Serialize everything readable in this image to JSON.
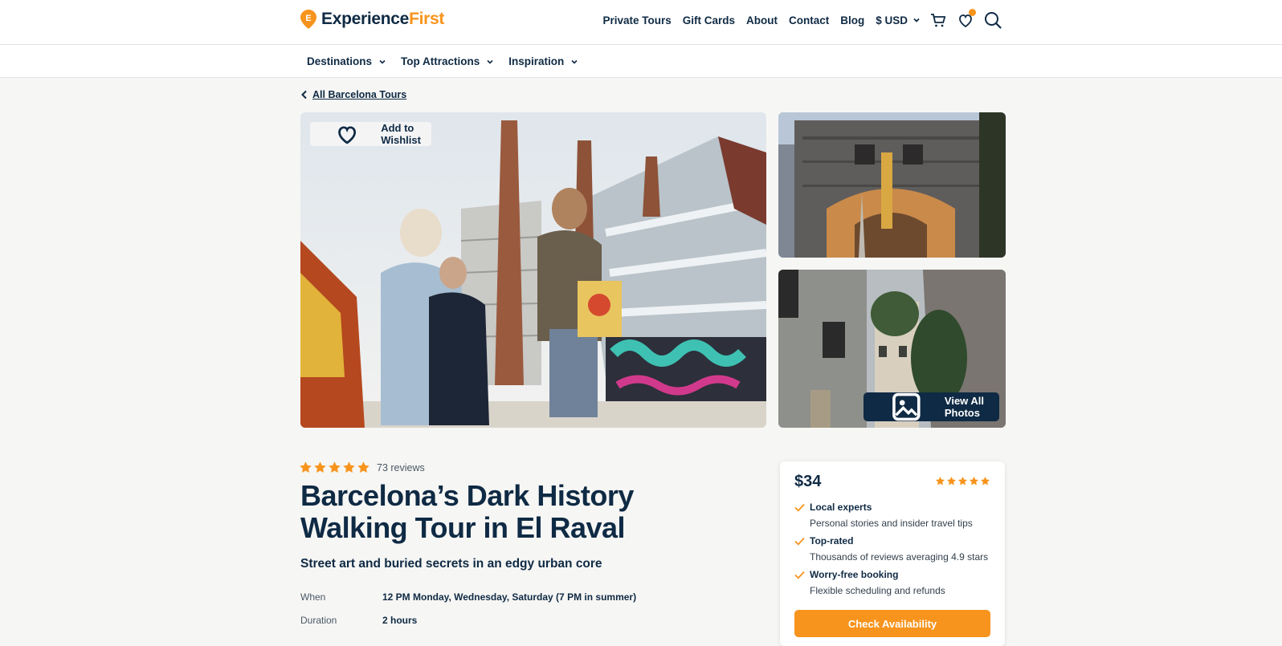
{
  "brand": {
    "name_main": "Experience",
    "name_accent": "First",
    "accent_color": "#f7941d",
    "primary_color": "#0f2a44"
  },
  "topnav": {
    "links": [
      "Private Tours",
      "Gift Cards",
      "About",
      "Contact",
      "Blog"
    ],
    "currency": "$ USD"
  },
  "subnav": {
    "items": [
      "Destinations",
      "Top Attractions",
      "Inspiration"
    ]
  },
  "breadcrumb": {
    "label": "All Barcelona Tours"
  },
  "gallery": {
    "wishlist_label": "Add to Wishlist",
    "view_all_label": "View All Photos"
  },
  "tour": {
    "rating": 5,
    "reviews": "73 reviews",
    "title": "Barcelona’s Dark History Walking Tour in El Raval",
    "subtitle": "Street art and buried secrets in an edgy urban core",
    "details": [
      {
        "label": "When",
        "value": "12 PM Monday, Wednesday, Saturday (7 PM in summer)"
      },
      {
        "label": "Duration",
        "value": "2 hours"
      }
    ]
  },
  "booking": {
    "price": "$34",
    "rating": 5,
    "features": [
      {
        "title": "Local experts",
        "desc": "Personal stories and insider travel tips"
      },
      {
        "title": "Top-rated",
        "desc": "Thousands of reviews averaging 4.9 stars"
      },
      {
        "title": "Worry-free booking",
        "desc": "Flexible scheduling and refunds"
      }
    ],
    "cta_label": "Check Availability"
  },
  "icons": [
    "logo-pin-icon",
    "chevron-down-icon",
    "cart-icon",
    "heart-icon",
    "search-icon",
    "chevron-left-icon",
    "image-icon",
    "star-icon",
    "check-icon"
  ]
}
